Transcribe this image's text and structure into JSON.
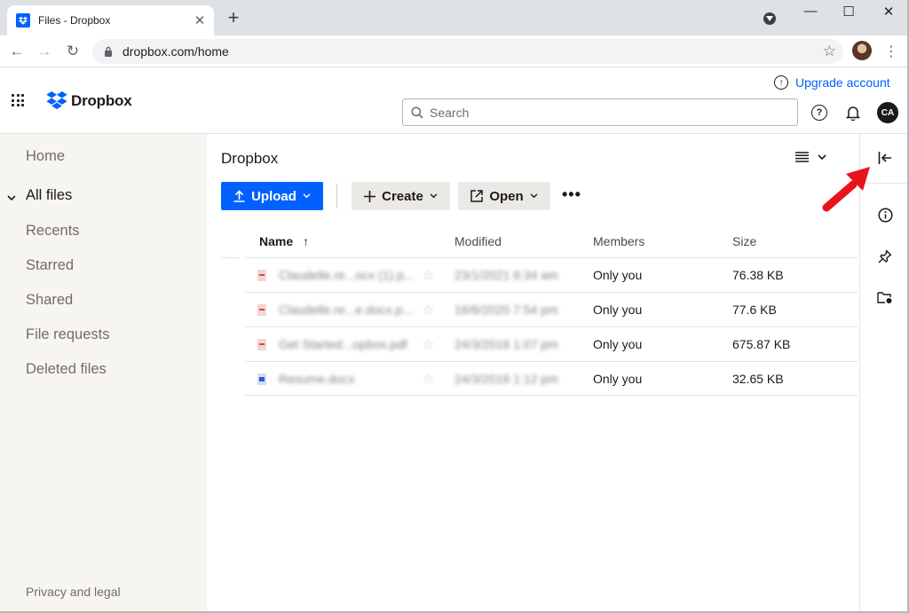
{
  "browser": {
    "tab_title": "Files - Dropbox",
    "new_tab": "+",
    "url": "dropbox.com/home",
    "window": {
      "minimize": "—",
      "maximize": "☐",
      "close": "✕"
    }
  },
  "header": {
    "logo_text": "Dropbox",
    "upgrade_label": "Upgrade account",
    "search_placeholder": "Search",
    "account_initials": "CA"
  },
  "sidebar": {
    "items": [
      {
        "label": "Home"
      },
      {
        "label": "All files",
        "active": true
      },
      {
        "label": "Recents"
      },
      {
        "label": "Starred"
      },
      {
        "label": "Shared"
      },
      {
        "label": "File requests"
      },
      {
        "label": "Deleted files"
      }
    ],
    "footer": "Privacy and legal"
  },
  "main": {
    "breadcrumb": "Dropbox",
    "actions": {
      "upload": "Upload",
      "create": "Create",
      "open": "Open",
      "more": "•••"
    },
    "columns": {
      "name": "Name",
      "modified": "Modified",
      "members": "Members",
      "size": "Size"
    },
    "rows": [
      {
        "name": "Claudelle.re...ocx (1).p...",
        "modified": "23/1/2021 8:34 am",
        "members": "Only you",
        "size": "76.38 KB",
        "type": "pdf"
      },
      {
        "name": "Claudelle.re...e.docx.p...",
        "modified": "16/6/2020 7:54 pm",
        "members": "Only you",
        "size": "77.6 KB",
        "type": "pdf"
      },
      {
        "name": "Get Started...opbox.pdf",
        "modified": "24/3/2016 1:07 pm",
        "members": "Only you",
        "size": "675.87 KB",
        "type": "pdf"
      },
      {
        "name": "Resume.docx",
        "modified": "24/3/2016 1:12 pm",
        "members": "Only you",
        "size": "32.65 KB",
        "type": "doc"
      }
    ]
  },
  "colors": {
    "accent": "#0061fe",
    "sidebar_bg": "#f7f5f2",
    "annotation_arrow": "#e8141b"
  }
}
